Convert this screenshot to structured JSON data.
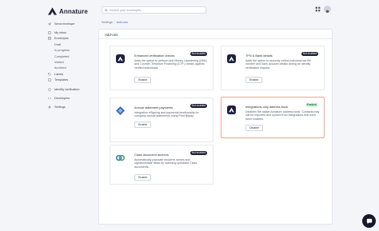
{
  "app": {
    "name": "Annature"
  },
  "sidebar": {
    "items": [
      {
        "label": "Send envelope",
        "icon": "send-icon",
        "level": 0
      },
      {
        "label": "My inbox",
        "icon": "inbox-icon",
        "level": 0
      },
      {
        "label": "Envelopes",
        "icon": "envelope-icon",
        "level": 0
      },
      {
        "label": "Draft",
        "level": 1
      },
      {
        "label": "In progress",
        "level": 1
      },
      {
        "label": "Completed",
        "level": 1
      },
      {
        "label": "Voided",
        "level": 1
      },
      {
        "label": "Archived",
        "level": 1
      },
      {
        "label": "Labels",
        "icon": "tag-icon",
        "level": 0
      },
      {
        "label": "Templates",
        "icon": "template-icon",
        "level": 0
      },
      {
        "label": "Identity verification",
        "icon": "identity-icon",
        "level": 0
      },
      {
        "label": "Developers",
        "icon": "code-icon",
        "level": 0
      },
      {
        "label": "Settings",
        "icon": "gear-icon",
        "level": 0
      }
    ]
  },
  "search": {
    "placeholder": "Search your envelopes..."
  },
  "breadcrumb": {
    "root": "Settings",
    "separator": "/",
    "current": "Add-ons"
  },
  "panel": {
    "title": "Add-ons"
  },
  "cards": [
    {
      "title": "Enhanced verification checks",
      "badge": "Not enabled",
      "enabled": false,
      "desc": "Adds the option to perform Anti Money Laundering (AML) and Counter-Terrorism Financing (CTF) checks against verified individuals.",
      "button": "Enable",
      "logo": "annature-logo"
    },
    {
      "title": "TFN & Bank details",
      "badge": "Not enabled",
      "enabled": false,
      "desc": "Adds the option to securely collect individual tax file number and bank account details during an identity verification request.",
      "button": "Enable",
      "logo": "annature-logo"
    },
    {
      "title": "Annual statement payments",
      "badge": "Not enabled",
      "enabled": false,
      "desc": "Integration eSigning and payments functionality for company annual statements using Print Bitpay.",
      "button": "Enable",
      "logo": "diamond-logo"
    },
    {
      "title": "Integrations-only address book",
      "badge": "Enabled",
      "enabled": true,
      "desc": "Disables the native Annature address book. Contacts may still be imported and synced from integrations that have been enabled.",
      "button": "Disable",
      "logo": "annature-logo"
    },
    {
      "title": "Class document anchors",
      "badge": "Not enabled",
      "enabled": false,
      "desc": "Automatically populate recipient names and signature/date fields by scanning uploaded Class documents.",
      "button": "Enable",
      "logo": "class-logo"
    }
  ],
  "colors": {
    "brand": "#1d2140",
    "accent_border": "#f0a48f",
    "badge_enabled_bg": "#d7f2de",
    "badge_disabled_bg": "#1f2237"
  }
}
